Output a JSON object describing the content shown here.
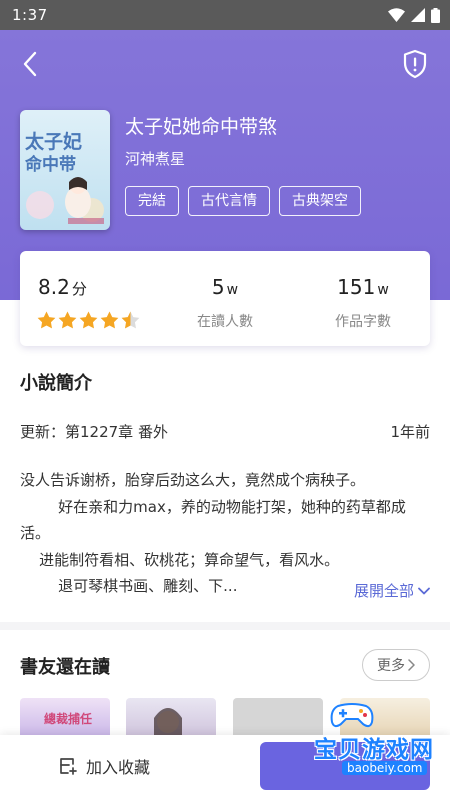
{
  "status_bar": {
    "time": "1:37"
  },
  "book": {
    "title": "太子妃她命中带煞",
    "author": "河神煮星",
    "tags": [
      "完結",
      "古代言情",
      "古典架空"
    ],
    "cover_title": "太子妃她命中带煞"
  },
  "stats": {
    "score": "8.2",
    "score_unit": "分",
    "rating_stars": 4.5,
    "readers_value": "5",
    "readers_unit": "w",
    "readers_label": "在讀人數",
    "words_value": "151",
    "words_unit": "w",
    "words_label": "作品字數"
  },
  "intro": {
    "title": "小說簡介",
    "update_label": "更新：第1227章 番外",
    "update_time": "1年前",
    "synopsis": "没人告诉谢桥，胎穿后劲这么大，竟然成个病秧子。\n        好在亲和力max，养的动物能打架，她种的药草都成活。\n    进能制符看相、砍桃花；算命望气，看风水。\n        退可琴棋书画、雕刻、下...",
    "expand_label": "展開全部"
  },
  "friends": {
    "title": "書友還在讀",
    "more_label": "更多",
    "thumb1_text": "總裁捕任"
  },
  "bottom": {
    "collect_label": "加入收藏"
  },
  "watermark": {
    "text": "宝贝游戏网",
    "url": "baobeiy.com"
  },
  "colors": {
    "hero": "#8575d9",
    "accent": "#6a64e0",
    "star": "#f5a623",
    "link": "#5b6ad6"
  }
}
